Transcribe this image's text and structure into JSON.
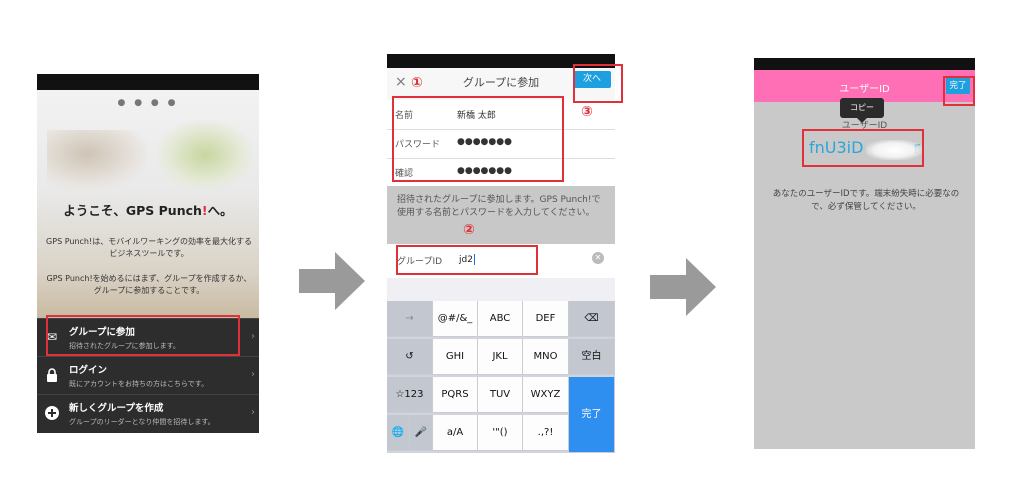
{
  "screen1": {
    "pagination_dots": "● ● ● ●",
    "welcome_prefix": "ようこそ、",
    "brand_main": "GPS Punch",
    "brand_pin": "!",
    "welcome_suffix": "へ。",
    "desc1": "GPS Punch!は、モバイルワーキングの効率を最大化するビジネスツールです。",
    "desc2": "GPS Punch!を始めるにはまず、グループを作成するか、グループに参加することです。",
    "menu": [
      {
        "title": "グループに参加",
        "subtitle": "招待されたグループに参加します。",
        "icon": "mail-icon"
      },
      {
        "title": "ログイン",
        "subtitle": "既にアカウントをお持ちの方はこちらです。",
        "icon": "lock-icon"
      },
      {
        "title": "新しくグループを作成",
        "subtitle": "グループのリーダーとなり仲間を招待します。",
        "icon": "plus-icon"
      }
    ]
  },
  "screen2": {
    "close": "×",
    "title": "グループに参加",
    "next": "次へ",
    "fields": [
      {
        "label": "名前",
        "value": "新橋 太郎"
      },
      {
        "label": "パスワード",
        "value": "●●●●●●●"
      },
      {
        "label": "確認",
        "value": "●●●●●●●"
      }
    ],
    "info": "招待されたグループに参加します。GPS Punch!で使用する名前とパスワードを入力してください。",
    "group_id_label": "グループID",
    "group_id_value": "jd2",
    "clear": "✕",
    "keyboard": {
      "row1": [
        "→",
        "@#/&_",
        "ABC",
        "DEF",
        "⌫"
      ],
      "row2": [
        "↺",
        "GHI",
        "JKL",
        "MNO",
        "空白"
      ],
      "row3": [
        "☆123",
        "PQRS",
        "TUV",
        "WXYZ"
      ],
      "row4": [
        "🌐",
        "🎤",
        "a/A",
        "'\"()",
        ".,?!"
      ],
      "done": "完了"
    }
  },
  "screen3": {
    "title": "ユーザーID",
    "done": "完了",
    "tooltip": "コピー",
    "uid_label": "ユーザーID",
    "uid_value": "fnU3iD",
    "uid_tail": "r",
    "message": "あなたのユーザーIDです。端末紛失時に必要なので、必ず保管してください。"
  },
  "annotations": {
    "n1": "①",
    "n2": "②",
    "n3": "③"
  },
  "colors": {
    "highlight": "#e0303a",
    "accent_blue": "#1e9fe0",
    "pink_bar": "#ff6fb5",
    "arrow": "#9a9a9a"
  }
}
